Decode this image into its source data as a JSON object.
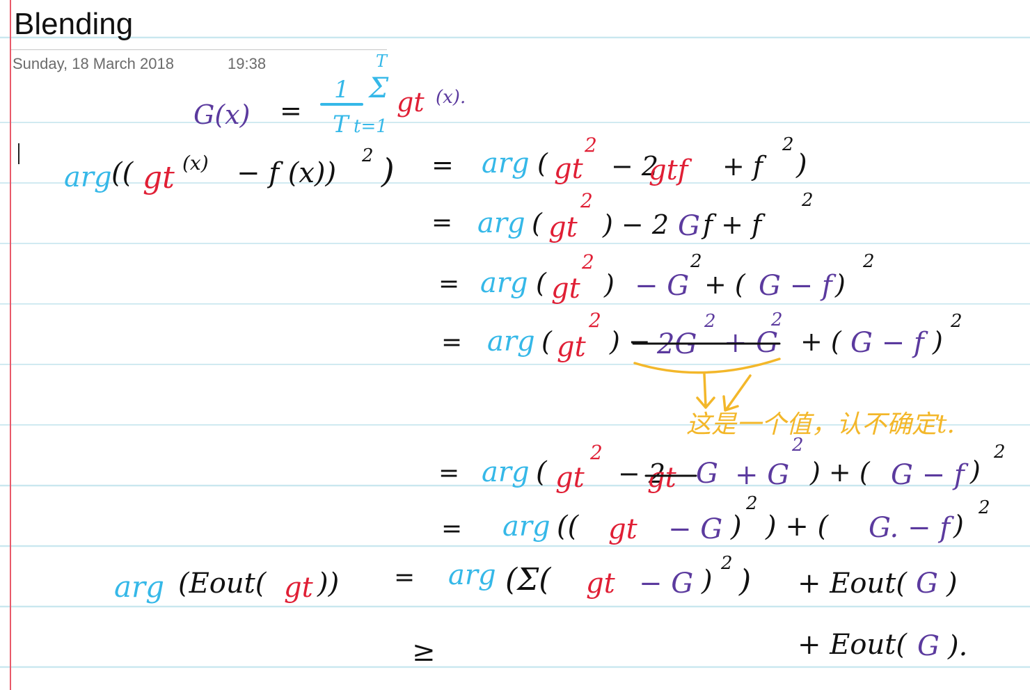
{
  "page": {
    "title": "Blending",
    "date": "Sunday, 18 March 2018",
    "time": "19:38"
  },
  "ink_colors": {
    "black": "#111111",
    "blue": "#35b8e8",
    "red": "#e01f35",
    "purple": "#5b3a9e",
    "orange": "#f3b72a"
  },
  "ink": {
    "line1": {
      "lhs": "G(x)",
      "eq": "=",
      "frac_num": "1",
      "frac_den": "T",
      "sum_sym": "Σ",
      "sum_top": "T",
      "sum_bot": "t=1",
      "gt": "gt",
      "arg": "(x)."
    },
    "line2": {
      "arg": "arg",
      "open": "((",
      "gt": "gt",
      "x1": "(x)",
      "mid": "− f (x))",
      "sq": "2",
      "close": ")",
      "eq": "=",
      "arg2": "arg",
      "p": "(",
      "gt2": "gt",
      "sq2": "2",
      "m2": "− 2",
      "gtf": "gtf",
      "rest": "+ f",
      "sq3": "2",
      "close2": ")"
    },
    "line3": {
      "eq": "=",
      "arg": "arg",
      "p": "(",
      "gt": "gt",
      "sq": "2",
      "mid": ") − 2",
      "G": "G",
      "rest": "f + f",
      "sq2": "2"
    },
    "line4": {
      "eq": "=",
      "arg": "arg",
      "p": "(",
      "gt": "gt",
      "sq": "2",
      "cl": ")",
      "mG": "− G",
      "sq2": "2",
      "pl": "+ (",
      "G": "G − f",
      "cl2": ")",
      "sq3": "2"
    },
    "line5": {
      "eq": "=",
      "arg": "arg",
      "p": "(",
      "gt": "gt",
      "sq": "2",
      "cl": ") −",
      "m2G": "2G",
      "sq2": "2",
      "pG": "+ G",
      "sq3": "2",
      "rest": "+ (",
      "G": "G − f",
      "cl2": ")",
      "sq4": "2"
    },
    "annotation": "这是一个值，认不确定t.",
    "line6": {
      "eq": "=",
      "arg": "arg",
      "p": "(",
      "gt": "gt",
      "sq": "2",
      "m": "− 2",
      "gtG": "gt",
      "G": "G",
      "pG": "+ G",
      "sq2": "2",
      "rest": ") + (",
      "G2": "G − f",
      "cl": ")",
      "sq3": "2"
    },
    "line7": {
      "eq": "=",
      "arg": "arg",
      "p": "((",
      "gt": "gt",
      "mG": "− G",
      "cl": ")",
      "sq": "2",
      "rest": ") + (",
      "G": "G. − f",
      "cl2": ")",
      "sq2": "2"
    },
    "line8": {
      "arg": "arg",
      "lhs": "(Eout(",
      "gt": "gt",
      "lhs2": "))",
      "eq": "=",
      "arg2": "arg",
      "p": "(Σ(",
      "gt2": "gt",
      "mG": "− G",
      "cl": ")",
      "sq": "2",
      "cl2": ")",
      "plus": "+ Eout(",
      "G": "G",
      "cl3": ")"
    },
    "line9": {
      "ge": "≥",
      "plus": "+ Eout(",
      "G": "G",
      "cl": ")."
    }
  }
}
